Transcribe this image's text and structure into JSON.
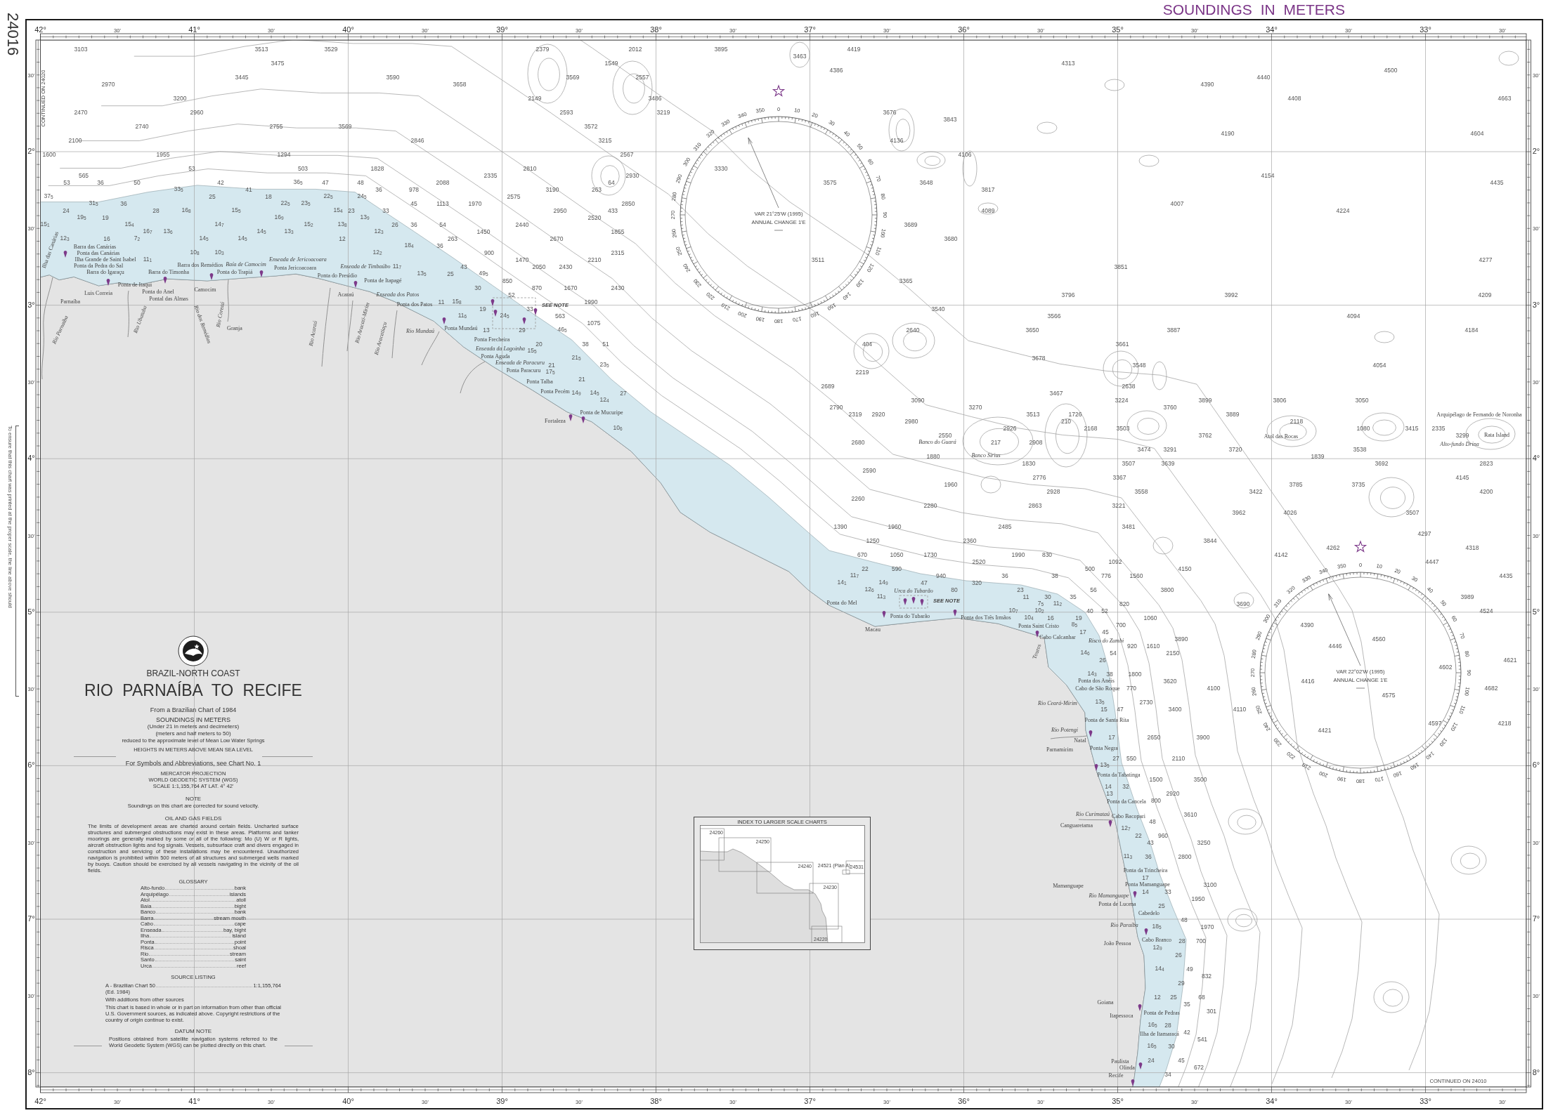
{
  "chart_number": "24016",
  "scale_check_note": "To ensure that this chart was printed at the proper scale, the line above should",
  "header": {
    "title": "SOUNDINGS IN METERS"
  },
  "longitude_scale_top": [
    "42°",
    "30'",
    "41°",
    "30'",
    "40°",
    "30'",
    "39°",
    "30'",
    "38°",
    "30'",
    "37°",
    "30'",
    "36°",
    "30'",
    "35°",
    "30'",
    "34°",
    "30'",
    "33°",
    "30'"
  ],
  "latitude_scale_left": [
    "30'",
    "2°",
    "30'",
    "3°",
    "30'",
    "4°",
    "30'",
    "5°",
    "30'",
    "6°",
    "30'",
    "7°",
    "30'",
    "8°"
  ],
  "latitude_scale_right": [
    "30'",
    "2°",
    "30'",
    "3°",
    "30'",
    "4°",
    "30'",
    "5°",
    "30'",
    "6°",
    "30'",
    "7°",
    "30'",
    "8°"
  ],
  "longitude_scale_bottom": [
    "42°",
    "30'",
    "41°",
    "30'",
    "40°",
    "30'",
    "39°",
    "30'",
    "38°",
    "30'",
    "37°",
    "30'",
    "36°",
    "30'",
    "35°",
    "30'",
    "34°",
    "30'",
    "33°",
    "30'"
  ],
  "title_block": {
    "region": "BRAZIL-NORTH COAST",
    "title": "RIO PARNAÍBA TO RECIFE",
    "source": "From a Brazilian Chart of 1984",
    "soundings": [
      "SOUNDINGS IN METERS",
      "(Under 21 in meters and decimeters)",
      "(meters and half meters to 50)",
      "reduced to the approximate level of Mean Low Water Springs"
    ],
    "heights": "HEIGHTS IN METERS ABOVE MEAN SEA LEVEL",
    "symbols": "For Symbols and Abbreviations, see Chart No. 1",
    "projection": [
      "MERCATOR PROJECTION",
      "WORLD GEODETIC SYSTEM (WGS)",
      "SCALE 1:1,155,764 AT LAT. 4° 42'"
    ]
  },
  "notes": [
    {
      "heading": "NOTE",
      "text": "Soundings on this chart are corrected for sound velocity."
    },
    {
      "heading": "OIL AND GAS FIELDS",
      "text": "The limits of development areas are charted around certain fields. Uncharted surface structures and submerged obstructions may exist in these areas. Platforms and tanker moorings are generally marked by some or all of the following: Mo (U) W or R lights, aircraft obstruction lights and fog signals. Vessels, subsurface craft and divers engaged in construction and servicing of these installations may be encountered. Unauthorized navigation is prohibited within 500 meters of all structures and submerged wells marked by buoys. Caution should be exercised by all vessels navigating in the vicinity of the oil fields."
    }
  ],
  "glossary": {
    "heading": "GLOSSARY",
    "entries": [
      {
        "term": "Alto-fundo",
        "meaning": "bank"
      },
      {
        "term": "Arquipélago",
        "meaning": "islands"
      },
      {
        "term": "Atol",
        "meaning": "atoll"
      },
      {
        "term": "Baía",
        "meaning": "bight"
      },
      {
        "term": "Banco",
        "meaning": "bank"
      },
      {
        "term": "Barra",
        "meaning": "stream mouth"
      },
      {
        "term": "Cabo",
        "meaning": "cape"
      },
      {
        "term": "Enseada",
        "meaning": "bay, bight"
      },
      {
        "term": "Ilha",
        "meaning": "island"
      },
      {
        "term": "Ponta",
        "meaning": "point"
      },
      {
        "term": "Risca",
        "meaning": "shoal"
      },
      {
        "term": "Rio",
        "meaning": "stream"
      },
      {
        "term": "Santo",
        "meaning": "saint"
      },
      {
        "term": "Urca",
        "meaning": "reef"
      }
    ]
  },
  "source_listing": {
    "heading": "SOURCE LISTING",
    "sources": [
      {
        "name": "A - Brazilian Chart 50",
        "scale": "1:1,155,764",
        "edition": "(Ed. 1984)"
      }
    ],
    "lines": [
      "With additions from other sources",
      "This chart is based in whole or in part on information from other than official U.S. Government sources, as indicated above. Copyright restrictions of the country of origin continue to exist."
    ]
  },
  "datum_note": {
    "heading": "DATUM NOTE",
    "text": "Positions obtained from satellite navigation systems referred to the World Geodetic System (WGS) can be plotted directly on this chart."
  },
  "index_inset": {
    "title": "INDEX TO LARGER SCALE CHARTS",
    "charts": [
      "24260",
      "24250",
      "24240",
      "24521 (Plan A)",
      "24531",
      "24230",
      "24220"
    ]
  },
  "compass_roses": [
    {
      "variation": "VAR 21°25'W (1995)",
      "annual_change": "ANNUAL CHANGE 1'E",
      "degrees": [
        "0",
        "10",
        "20",
        "30",
        "40",
        "50",
        "60",
        "70",
        "80",
        "90",
        "100",
        "110",
        "120",
        "130",
        "140",
        "150",
        "160",
        "170",
        "180",
        "190",
        "200",
        "210",
        "220",
        "230",
        "240",
        "250",
        "260",
        "270",
        "280",
        "290",
        "300",
        "310",
        "320",
        "330",
        "340",
        "350"
      ]
    },
    {
      "variation": "VAR 22°02'W (1995)",
      "annual_change": "ANNUAL CHANGE 1'E",
      "degrees": [
        "0",
        "10",
        "20",
        "30",
        "40",
        "50",
        "60",
        "70",
        "80",
        "90",
        "100",
        "110",
        "120",
        "130",
        "140",
        "150",
        "160",
        "170",
        "180",
        "190",
        "200",
        "210",
        "220",
        "230",
        "240",
        "250",
        "260",
        "270",
        "280",
        "290",
        "300",
        "310",
        "320",
        "330",
        "340",
        "350"
      ]
    }
  ],
  "place_names": [
    {
      "name": "Ilha das Canárias",
      "kind": "feature"
    },
    {
      "name": "Barra das Canárias",
      "kind": "feature"
    },
    {
      "name": "Ponta das Canárias",
      "kind": "feature"
    },
    {
      "name": "Ilha Grande de Saint Isabel",
      "kind": "feature"
    },
    {
      "name": "Enseada de Jericoacoara",
      "kind": "water"
    },
    {
      "name": "Ponta da Pedra do Sal",
      "kind": "feature"
    },
    {
      "name": "Barra dos Remédios",
      "kind": "feature"
    },
    {
      "name": "Baía de Camocim",
      "kind": "water"
    },
    {
      "name": "Ponta Jericoacoara",
      "kind": "feature"
    },
    {
      "name": "Enseada de Timbaúbo",
      "kind": "water"
    },
    {
      "name": "Barra do Igaraçu",
      "kind": "feature"
    },
    {
      "name": "Barra do Timonha",
      "kind": "feature"
    },
    {
      "name": "Ponta do Trapiá",
      "kind": "feature"
    },
    {
      "name": "Ponta do Presídio",
      "kind": "feature"
    },
    {
      "name": "Ponta de Itaqui",
      "kind": "feature"
    },
    {
      "name": "Ponta de Itapagé",
      "kind": "feature"
    },
    {
      "name": "Luis Correia",
      "kind": "feature"
    },
    {
      "name": "Ponta do Anel",
      "kind": "feature"
    },
    {
      "name": "Camocim",
      "kind": "feature"
    },
    {
      "name": "Acaraú",
      "kind": "feature"
    },
    {
      "name": "Enseada dos Patos",
      "kind": "water"
    },
    {
      "name": "Parnaíba",
      "kind": "feature"
    },
    {
      "name": "Pontal das Almas",
      "kind": "feature"
    },
    {
      "name": "Ponta dos Patos",
      "kind": "feature"
    },
    {
      "name": "Rio Parnaíba",
      "kind": "water"
    },
    {
      "name": "Rio Ubatuba",
      "kind": "water"
    },
    {
      "name": "Rio dos Remédios",
      "kind": "water"
    },
    {
      "name": "Rio Coreaú",
      "kind": "water"
    },
    {
      "name": "Granja",
      "kind": "feature"
    },
    {
      "name": "Rio Acaraú",
      "kind": "water"
    },
    {
      "name": "Rio Aracati-Mirim",
      "kind": "water"
    },
    {
      "name": "Rio Aracatiaçu",
      "kind": "water"
    },
    {
      "name": "Rio Mundaú",
      "kind": "water"
    },
    {
      "name": "Ponta Mundaú",
      "kind": "feature"
    },
    {
      "name": "Ponta Frecheira",
      "kind": "feature"
    },
    {
      "name": "Enseada da Lagoinha",
      "kind": "water"
    },
    {
      "name": "Ponta Aguda",
      "kind": "feature"
    },
    {
      "name": "Enseada de Paracuru",
      "kind": "water"
    },
    {
      "name": "Ponta Paracuru",
      "kind": "feature"
    },
    {
      "name": "Ponta Talba",
      "kind": "feature"
    },
    {
      "name": "Ponta Pecém",
      "kind": "feature"
    },
    {
      "name": "Ponta de Mucuripe",
      "kind": "feature"
    },
    {
      "name": "Arquipélago de Fernando de Noronha",
      "kind": "feature"
    },
    {
      "name": "Fortaleza",
      "kind": "feature"
    },
    {
      "name": "Atol das Rocas",
      "kind": "feature"
    },
    {
      "name": "Rata Island",
      "kind": "feature"
    },
    {
      "name": "Banco do Guará",
      "kind": "water"
    },
    {
      "name": "Alto-fundo Drina",
      "kind": "water"
    },
    {
      "name": "Banco Sirius",
      "kind": "water"
    },
    {
      "name": "Urca do Tubarão",
      "kind": "water"
    },
    {
      "name": "Ponta do Mel",
      "kind": "feature"
    },
    {
      "name": "Ponta do Tubarão",
      "kind": "feature"
    },
    {
      "name": "Ponta dos Três Irmãos",
      "kind": "feature"
    },
    {
      "name": "Macau",
      "kind": "feature"
    },
    {
      "name": "Ponta Saint Cristo",
      "kind": "feature"
    },
    {
      "name": "Cabo Calcanhar",
      "kind": "feature"
    },
    {
      "name": "Risco do Zumbi",
      "kind": "water"
    },
    {
      "name": "Touros",
      "kind": "feature"
    },
    {
      "name": "Ponta dos Anéis",
      "kind": "feature"
    },
    {
      "name": "Cabo de São Roque",
      "kind": "feature"
    },
    {
      "name": "Rio Ceará-Mirim",
      "kind": "water"
    },
    {
      "name": "Ponta de Santa Rita",
      "kind": "feature"
    },
    {
      "name": "Rio Potengi",
      "kind": "water"
    },
    {
      "name": "Natal",
      "kind": "feature"
    },
    {
      "name": "Parnamirim",
      "kind": "feature"
    },
    {
      "name": "Ponta Negra",
      "kind": "feature"
    },
    {
      "name": "Ponta da Tabatinga",
      "kind": "feature"
    },
    {
      "name": "Ponta da Cancela",
      "kind": "feature"
    },
    {
      "name": "Rio Curimataú",
      "kind": "water"
    },
    {
      "name": "Cabo Bacopari",
      "kind": "feature"
    },
    {
      "name": "Canguaretama",
      "kind": "feature"
    },
    {
      "name": "Ponta da Trincheira",
      "kind": "feature"
    },
    {
      "name": "Mamanguape",
      "kind": "feature"
    },
    {
      "name": "Ponta Mamanguape",
      "kind": "feature"
    },
    {
      "name": "Rio Mamanguape",
      "kind": "water"
    },
    {
      "name": "Ponta de Lucena",
      "kind": "feature"
    },
    {
      "name": "Cabedelo",
      "kind": "feature"
    },
    {
      "name": "Rio Paraíba",
      "kind": "water"
    },
    {
      "name": "João Pessoa",
      "kind": "feature"
    },
    {
      "name": "Cabo Branco",
      "kind": "feature"
    },
    {
      "name": "Goiana",
      "kind": "feature"
    },
    {
      "name": "Itapessoca",
      "kind": "feature"
    },
    {
      "name": "Ponta de Pedras",
      "kind": "feature"
    },
    {
      "name": "Ilha de Itamaracá",
      "kind": "feature"
    },
    {
      "name": "Paulista",
      "kind": "feature"
    },
    {
      "name": "Olinda",
      "kind": "feature"
    },
    {
      "name": "Recife",
      "kind": "feature"
    }
  ],
  "soundings": [
    "3103",
    "3513",
    "3529",
    "2379",
    "2012",
    "3895",
    "4419",
    "3463",
    "3475",
    "1549",
    "4313",
    "4386",
    "4500",
    "3445",
    "3590",
    "3569",
    "2557",
    "4440",
    "2970",
    "3658",
    "4390",
    "3200",
    "2149",
    "3486",
    "4408",
    "4663",
    "2470",
    "2960",
    "2593",
    "3219",
    "3676",
    "3843",
    "2740",
    "2755",
    "3569",
    "3572",
    "4190",
    "4604",
    "2100",
    "2846",
    "3215",
    "4136",
    "1600",
    "1955",
    "1294",
    "2567",
    "4106",
    "53",
    "503",
    "1828",
    "2810",
    "3330",
    "565",
    "2335",
    "2930",
    "4154",
    "53",
    "36",
    "50",
    "42",
    "36$_{5}$",
    "47",
    "48",
    "2088",
    "64",
    "3575",
    "3648",
    "4435",
    "33$_{5}$",
    "41",
    "36",
    "978",
    "3190",
    "263",
    "3817",
    "37$_{5}$",
    "25",
    "18",
    "22$_{5}$",
    "24$_{5}$",
    "2575",
    "31$_{5}$",
    "36",
    "22$_{5}$",
    "23$_{5}$",
    "45",
    "1113",
    "1970",
    "2850",
    "4007",
    "24",
    "28",
    "16$_{8}$",
    "15$_{5}$",
    "15$_{4}$",
    "23",
    "33",
    "2950",
    "433",
    "4089",
    "4224",
    "19$_{5}$",
    "19",
    "16$_{9}$",
    "13$_{9}$",
    "2520",
    "15$_{1}$",
    "15$_{4}$",
    "14$_{7}$",
    "15$_{2}$",
    "13$_{8}$",
    "26",
    "36",
    "54",
    "2440",
    "3689",
    "16$_{7}$",
    "13$_{6}$",
    "14$_{5}$",
    "13$_{3}$",
    "12$_{3}$",
    "1450",
    "1855",
    "12$_{3}$",
    "16",
    "7$_{2}$",
    "14$_{5}$",
    "14$_{5}$",
    "12",
    "263",
    "2670",
    "3680",
    "18$_{4}$",
    "36",
    "10$_{8}$",
    "10$_{3}$",
    "12$_{2}$",
    "900",
    "2315",
    "11$_{1}$",
    "1470",
    "2210",
    "3511",
    "4277",
    "11$_{7}$",
    "43",
    "2050",
    "2430",
    "3851",
    "13$_{5}$",
    "25",
    "49$_{5}$",
    "850",
    "3365",
    "30",
    "870",
    "1670",
    "2430",
    "52",
    "3796",
    "3992",
    "4209",
    "11",
    "15$_{8}$",
    "1990",
    "19",
    "33",
    "3540",
    "11$_{6}$",
    "24$_{5}$",
    "563",
    "3566",
    "4094",
    "1075",
    "13",
    "29",
    "46$_{5}$",
    "2640",
    "3650",
    "3887",
    "4184",
    "20",
    "38",
    "51",
    "404",
    "3661",
    "15$_{5}$",
    "21$_{5}$",
    "3678",
    "21",
    "23$_{5}$",
    "3548",
    "4054",
    "17$_{5}$",
    "2219",
    "21",
    "2689",
    "2638",
    "14$_{9}$",
    "14$_{5}$",
    "27",
    "3467",
    "12$_{4}$",
    "3090",
    "3224",
    "3899",
    "3806",
    "3050",
    "2790",
    "3270",
    "3760",
    "2319",
    "2920",
    "3513",
    "1726",
    "3889",
    "2980",
    "210",
    "2118",
    "10$_{6}$",
    "2926",
    "2168",
    "3503",
    "1080",
    "3415",
    "2335",
    "2550",
    "3762",
    "3299",
    "2680",
    "217",
    "2908",
    "3474",
    "3291",
    "3720",
    "3538",
    "1880",
    "1839",
    "1830",
    "3507",
    "3639",
    "3692",
    "2823",
    "2590",
    "2776",
    "3367",
    "4145",
    "1960",
    "3785",
    "3735",
    "2928",
    "3558",
    "3422",
    "4200",
    "2260",
    "2280",
    "2863",
    "3221",
    "3962",
    "4026",
    "3507",
    "1390",
    "1960",
    "2485",
    "3481",
    "4297",
    "1250",
    "2360",
    "3844",
    "4262",
    "4318",
    "670",
    "1050",
    "1730",
    "1990",
    "830",
    "4142",
    "2520",
    "1092",
    "4447",
    "22",
    "590",
    "500",
    "4150",
    "11$_{7}$",
    "940",
    "36",
    "38",
    "776",
    "1560",
    "4435",
    "14$_{1}$",
    "14$_{9}$",
    "47",
    "320",
    "12$_{6}$",
    "80",
    "23",
    "56",
    "3800",
    "11$_{3}$",
    "11",
    "30",
    "35",
    "3989",
    "7$_{5}$",
    "11$_{2}$",
    "820",
    "3690",
    "10$_{7}$",
    "10$_{2}$",
    "40",
    "52",
    "4524",
    "10$_{4}$",
    "16",
    "19",
    "1060",
    "8$_{5}$",
    "700",
    "4390",
    "17",
    "45",
    "3890",
    "4560",
    "920",
    "1610",
    "4446",
    "14$_{6}$",
    "54",
    "2150",
    "26",
    "4621",
    "4602",
    "14$_{3}$",
    "38",
    "1800",
    "3620",
    "4416",
    "770",
    "4100",
    "4682",
    "4575",
    "13$_{5}$",
    "2730",
    "15",
    "47",
    "3400",
    "4110",
    "4597",
    "4218",
    "4421",
    "17",
    "2650",
    "3900",
    "27",
    "550",
    "2110",
    "13$_{5}$",
    "1500",
    "3500",
    "14",
    "32",
    "13",
    "2920",
    "800",
    "3610",
    "48",
    "12$_{7}$",
    "22",
    "960",
    "43",
    "3250",
    "11$_{3}$",
    "36",
    "2800",
    "17",
    "3100",
    "14",
    "33",
    "1950",
    "25",
    "48",
    "18$_{5}$",
    "1970",
    "28",
    "700",
    "12$_{9}$",
    "26",
    "14$_{4}$",
    "49",
    "832",
    "29",
    "12",
    "25",
    "68",
    "35",
    "301",
    "16$_{5}$",
    "28",
    "42",
    "541",
    "16$_{5}$",
    "30",
    "24",
    "45",
    "672",
    "34"
  ],
  "see_notes": [
    "SEE NOTE",
    "SEE NOTE"
  ],
  "continuation_notes": [
    "CONTINUED ON 24020",
    "CONTINUED ON 24010"
  ]
}
